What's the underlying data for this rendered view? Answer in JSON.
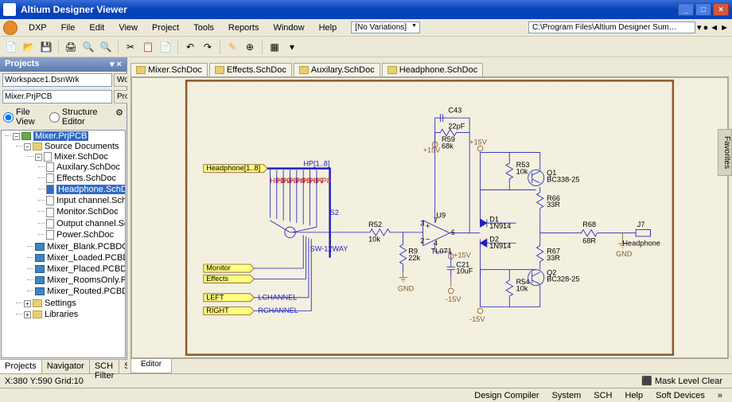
{
  "window": {
    "title": "Altium Designer Viewer"
  },
  "menus": {
    "dxp": "DXP",
    "file": "File",
    "edit": "Edit",
    "view": "View",
    "project": "Project",
    "tools": "Tools",
    "reports": "Reports",
    "window": "Window",
    "help": "Help"
  },
  "variations_label": "[No Variations]",
  "path_field": "C:\\Program Files\\Altium Designer Sum…",
  "panel": {
    "title": "Projects",
    "workspace_val": "Workspace1.DsnWrk",
    "workspace_btn": "Workspace",
    "project_val": "Mixer.PrjPCB",
    "project_btn": "Project",
    "radio_file": "File View",
    "radio_struct": "Structure Editor"
  },
  "tree": {
    "root": "Mixer.PrjPCB",
    "src": "Source Documents",
    "mixer_schdoc": "Mixer.SchDoc",
    "items": [
      "Auxilary.SchDoc",
      "Effects.SchDoc",
      "Headphone.SchDoc",
      "Input channel.SchDoc",
      "Monitor.SchDoc",
      "Output channel.SchDoc",
      "Power.SchDoc"
    ],
    "pcb": [
      "Mixer_Blank.PCBDOC",
      "Mixer_Loaded.PCBDOC",
      "Mixer_Placed.PCBDOC",
      "Mixer_RoomsOnly.PCBDOC",
      "Mixer_Routed.PCBDOC"
    ],
    "settings": "Settings",
    "libraries": "Libraries"
  },
  "sidetabs": {
    "projects": "Projects",
    "navigator": "Navigator",
    "schfilter": "SCH Filter",
    "sh": "SH"
  },
  "doctabs": {
    "mixer": "Mixer.SchDoc",
    "effects": "Effects.SchDoc",
    "auxilary": "Auxilary.SchDoc",
    "headphone": "Headphone.SchDoc"
  },
  "editor_tab": "Editor",
  "status": {
    "coord": "X:380 Y:590  Grid:10",
    "dc": "Design Compiler",
    "sys": "System",
    "sch": "SCH",
    "help": "Help",
    "sd": "Soft Devices"
  },
  "right_tab": "Favorites",
  "schematic": {
    "ports": {
      "headphone": "Headphone[1..8]",
      "monitor": "Monitor",
      "effects": "Effects",
      "left": "LEFT",
      "right": "RIGHT"
    },
    "nets": {
      "lch": "LCHANNEL",
      "rch": "RCHANNEL",
      "hpbus": "HP[1..8]",
      "hp1": "HP1",
      "hp2": "HP2",
      "hp3": "HP3",
      "hp4": "HP4",
      "hp5": "HP5",
      "hp6": "HP6",
      "hp7": "HP7",
      "hp8": "HP8"
    },
    "labels": {
      "s2": "S2",
      "sw": "SW-12WAY",
      "r52": "R52",
      "r52v": "10k",
      "r9": "R9",
      "r9v": "22k",
      "u9": "U9",
      "op": "TL071",
      "c21": "C21",
      "c21v": "10uF",
      "c43": "C43",
      "c43v": "22pF",
      "r59": "R59",
      "r59v": "68k",
      "d1": "D1",
      "d1v": "1N914",
      "d2": "D2",
      "d2v": "1N914",
      "q1": "Q1",
      "q1v": "BC338-25",
      "q2": "Q2",
      "q2v": "BC328-25",
      "r53": "R53",
      "r53v": "10k",
      "r54": "R54",
      "r54v": "10k",
      "r66": "R66",
      "r66v": "33R",
      "r67": "R67",
      "r67v": "33R",
      "r68": "R68",
      "r68v": "68R",
      "j7": "J7",
      "j7v": "Headphone",
      "gnd": "GND",
      "p15": "+15V",
      "m15": "-15V"
    }
  }
}
